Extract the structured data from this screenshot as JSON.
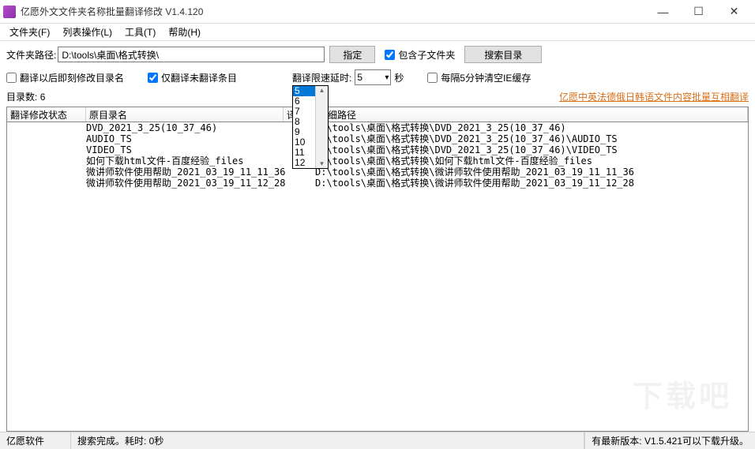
{
  "window": {
    "title": "亿愿外文文件夹名称批量翻译修改 V1.4.120",
    "min": "—",
    "max": "☐",
    "close": "✕"
  },
  "menu": {
    "folder": "文件夹(F)",
    "listop": "列表操作(L)",
    "tools": "工具(T)",
    "help": "帮助(H)"
  },
  "toolbar": {
    "path_label": "文件夹路径:",
    "path_value": "D:\\tools\\桌面\\格式转换\\",
    "assign_btn": "指定",
    "include_sub": "包含子文件夹",
    "search_btn": "搜索目录"
  },
  "options": {
    "immediate_modify": "翻译以后即刻修改目录名",
    "only_untranslated": "仅翻译未翻译条目",
    "delay_label": "翻译限速延时:",
    "delay_value": "5",
    "delay_unit": "秒",
    "dropdown": [
      "5",
      "6",
      "7",
      "8",
      "9",
      "10",
      "11",
      "12"
    ],
    "clear_ie": "每隔5分钟清空IE缓存"
  },
  "row3": {
    "count_label": "目录数:",
    "count_value": "6",
    "promo_link": "亿愿中英法德俄日韩语文件内容批量互相翻译"
  },
  "columns": {
    "status": "翻译修改状态",
    "orig": "原目录名",
    "trans": "译文",
    "detail": "详细路径"
  },
  "rows": [
    {
      "orig": "DVD_2021_3_25(10_37_46)",
      "detail": "D:\\tools\\桌面\\格式转换\\DVD_2021_3_25(10_37_46)"
    },
    {
      "orig": "AUDIO_TS",
      "detail": "D:\\tools\\桌面\\格式转换\\DVD_2021_3_25(10_37_46)\\AUDIO_TS"
    },
    {
      "orig": "VIDEO_TS",
      "detail": "D:\\tools\\桌面\\格式转换\\DVD_2021_3_25(10_37_46)\\VIDEO_TS"
    },
    {
      "orig": "如何下载html文件-百度经验_files",
      "detail": "D:\\tools\\桌面\\格式转换\\如何下载html文件-百度经验_files"
    },
    {
      "orig": "微讲师软件使用帮助_2021_03_19_11_11_36",
      "detail": "D:\\tools\\桌面\\格式转换\\微讲师软件使用帮助_2021_03_19_11_11_36"
    },
    {
      "orig": "微讲师软件使用帮助_2021_03_19_11_12_28",
      "detail": "D:\\tools\\桌面\\格式转换\\微讲师软件使用帮助_2021_03_19_11_12_28"
    }
  ],
  "watermark": "下载吧",
  "status": {
    "left": "亿愿软件",
    "mid": "搜索完成。耗时: 0秒",
    "right": "有最新版本: V1.5.421可以下载升级。"
  }
}
